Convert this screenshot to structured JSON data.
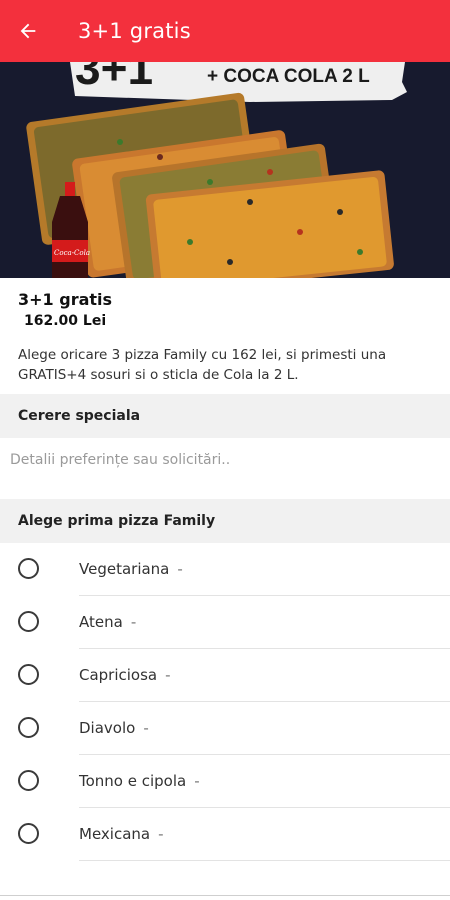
{
  "appbar": {
    "title": "3+1 gratis",
    "back_icon": "arrow-left-icon"
  },
  "hero": {
    "promo_text": "+ COCA COLA 2 L",
    "big_text": "3+1",
    "bottle_label": "Coca-Cola"
  },
  "product": {
    "name": "3+1 gratis",
    "price": "162.00 Lei",
    "description": "Alege oricare 3 pizza Family cu 162 lei, si primesti una GRATIS+4 sosuri si o sticla de Cola la 2 L."
  },
  "special_request": {
    "header": "Cerere speciala",
    "placeholder": "Detalii preferințe sau solicitări.."
  },
  "pizza_choice": {
    "header": "Alege prima pizza Family",
    "options": [
      {
        "label": "Vegetariana",
        "dash": "-"
      },
      {
        "label": "Atena",
        "dash": "-"
      },
      {
        "label": "Capriciosa",
        "dash": "-"
      },
      {
        "label": "Diavolo",
        "dash": "-"
      },
      {
        "label": "Tonno e cipola",
        "dash": "-"
      },
      {
        "label": "Mexicana",
        "dash": "-"
      }
    ]
  },
  "colors": {
    "primary": "#f3303d",
    "section_bg": "#f1f1f1"
  }
}
